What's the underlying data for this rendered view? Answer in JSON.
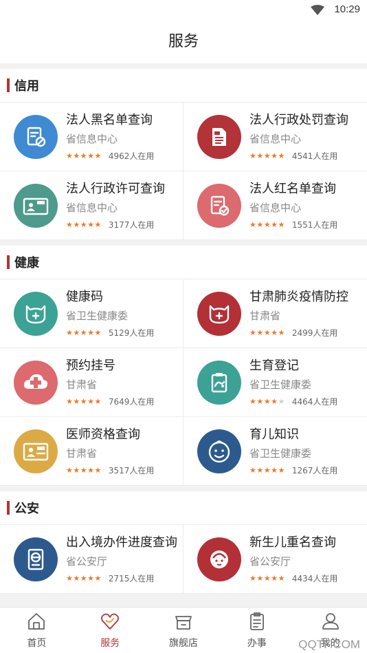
{
  "status_bar": {
    "time": "10:29"
  },
  "header": {
    "title": "服务"
  },
  "sections": [
    {
      "title": "信用",
      "items": [
        {
          "name": "法人黑名单查询",
          "org": "省信息中心",
          "users": "4962人在用",
          "rating": 5,
          "icon": "blacklist-doc-icon",
          "color": "#3f8ad2"
        },
        {
          "name": "法人行政处罚查询",
          "org": "省信息中心",
          "users": "4541人在用",
          "rating": 5,
          "icon": "penalty-doc-icon",
          "color": "#b23338"
        },
        {
          "name": "法人行政许可查询",
          "org": "省信息中心",
          "users": "3177人在用",
          "rating": 5,
          "icon": "license-card-icon",
          "color": "#4e9a8c"
        },
        {
          "name": "法人红名单查询",
          "org": "省信息中心",
          "users": "1551人在用",
          "rating": 5,
          "icon": "redlist-doc-icon",
          "color": "#dc6a6e"
        }
      ]
    },
    {
      "title": "健康",
      "items": [
        {
          "name": "健康码",
          "org": "省卫生健康委",
          "users": "5129人在用",
          "rating": 5,
          "icon": "health-code-icon",
          "color": "#3ba295"
        },
        {
          "name": "甘肃肺炎疫情防控",
          "org": "甘肃省",
          "users": "2499人在用",
          "rating": 5,
          "icon": "epidemic-icon",
          "color": "#b33037"
        },
        {
          "name": "预约挂号",
          "org": "甘肃省",
          "users": "7649人在用",
          "rating": 5,
          "icon": "appointment-icon",
          "color": "#dc6a6e"
        },
        {
          "name": "生育登记",
          "org": "省卫生健康委",
          "users": "4464人在用",
          "rating": 4,
          "icon": "birth-register-icon",
          "color": "#3ba295"
        },
        {
          "name": "医师资格查询",
          "org": "甘肃省",
          "users": "3517人在用",
          "rating": 5,
          "icon": "doctor-cert-icon",
          "color": "#dcaa45"
        },
        {
          "name": "育儿知识",
          "org": "省卫生健康委",
          "users": "1267人在用",
          "rating": 5,
          "icon": "baby-face-icon",
          "color": "#2d5a8e"
        }
      ]
    },
    {
      "title": "公安",
      "items": [
        {
          "name": "出入境办件进度查询",
          "org": "省公安厅",
          "users": "2715人在用",
          "rating": 5,
          "icon": "passport-icon",
          "color": "#2d5a8e"
        },
        {
          "name": "新生儿重名查询",
          "org": "省公安厅",
          "users": "4434人在用",
          "rating": 5,
          "icon": "newborn-icon",
          "color": "#b33037"
        }
      ]
    }
  ],
  "tabbar": {
    "tabs": [
      {
        "label": "首页",
        "icon": "home-icon",
        "active": false
      },
      {
        "label": "服务",
        "icon": "service-heart-icon",
        "active": true
      },
      {
        "label": "旗舰店",
        "icon": "store-icon",
        "active": false
      },
      {
        "label": "办事",
        "icon": "clipboard-icon",
        "active": false
      },
      {
        "label": "我的",
        "icon": "user-icon",
        "active": false
      }
    ]
  },
  "watermark": "QQTF.COM",
  "colors": {
    "accent": "#b23338",
    "star": "#f07828",
    "star_off": "#cfcfcf"
  }
}
